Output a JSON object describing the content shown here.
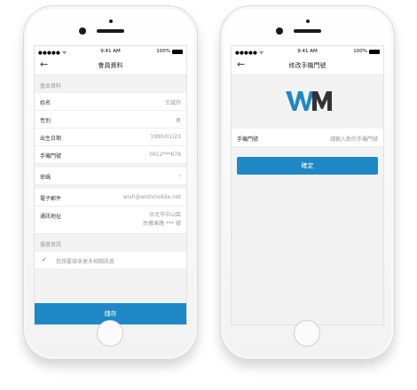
{
  "colors": {
    "accent": "#1e88c7",
    "logo_dark": "#333333"
  },
  "status_bar": {
    "carrier": "●●●●● ᯤ",
    "time": "9:41 AM",
    "battery": "100%"
  },
  "left_screen": {
    "title": "會員資料",
    "back_icon": "←",
    "basic_section": "基本資料",
    "fields": [
      {
        "label": "姓名",
        "value": "王威許"
      },
      {
        "label": "性別",
        "value": "男"
      },
      {
        "label": "出生日期",
        "value": "1990/01/23"
      },
      {
        "label": "手機門號",
        "value": "0912***678"
      }
    ],
    "password_label": "密碼",
    "chevron": "›",
    "email": {
      "label": "電子郵件",
      "value": "wish@wishmobile.net"
    },
    "address": {
      "label": "通訊地址",
      "line1": "台北市中山區",
      "line2": "民權東路 *** 號"
    },
    "promo_section": "優惠資訊",
    "promo_check_icon": "✓",
    "promo_label": "我想要接收更多相關訊息",
    "save_label": "儲存"
  },
  "right_screen": {
    "title": "修改手機門號",
    "back_icon": "←",
    "logo_text": "WM",
    "phone_label": "手機門號",
    "phone_placeholder": "請輸入新的手機門號",
    "confirm_label": "確定"
  }
}
